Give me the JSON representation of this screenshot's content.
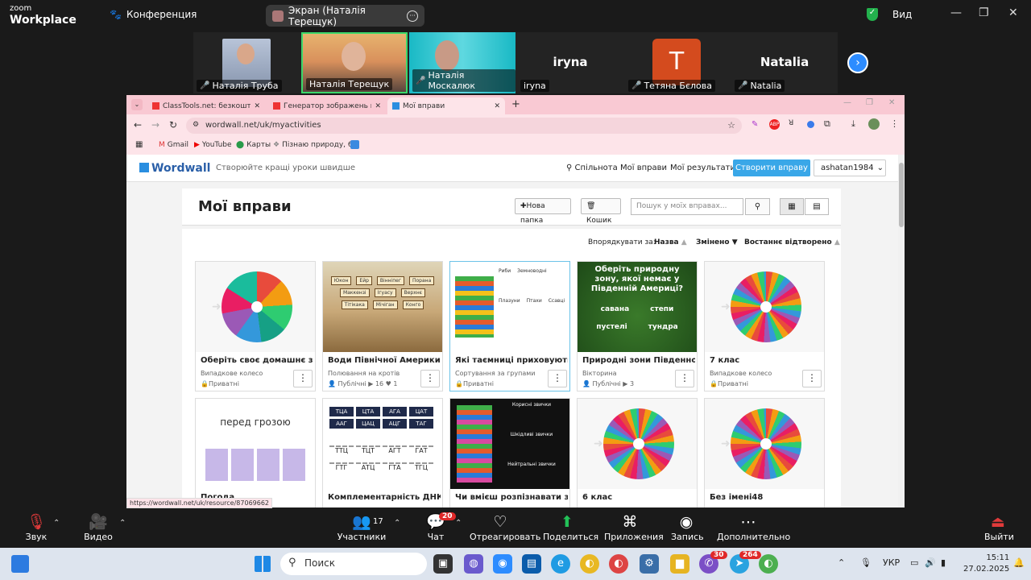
{
  "zoom": {
    "logo_top": "zoom",
    "logo_bottom": "Workplace",
    "meeting_label": "Конференция",
    "screen_share": "Экран (Наталія Терещук)",
    "view_label": "Вид",
    "participants": [
      {
        "name": "Наталія Труба",
        "type": "video"
      },
      {
        "name": "Наталія Терещук",
        "type": "video"
      },
      {
        "name": "Наталія Москалюк",
        "type": "video"
      },
      {
        "name": "iryna",
        "type": "text",
        "big": "iryna"
      },
      {
        "name": "Тетяна Бєлова",
        "type": "avatar",
        "big": "T"
      },
      {
        "name": "Natalia",
        "type": "text",
        "big": "Natalia"
      }
    ],
    "toolbar": {
      "audio": "Звук",
      "video": "Видео",
      "participants": "Участники",
      "participants_count": "17",
      "chat": "Чат",
      "chat_badge": "20",
      "react": "Отреагировать",
      "share": "Поделиться",
      "apps": "Приложения",
      "record": "Запись",
      "more": "Дополнительно",
      "leave": "Выйти"
    }
  },
  "browser": {
    "tabs": [
      {
        "label": "ClassTools.net: безкоштовні ін"
      },
      {
        "label": "Генератор зображень профіл"
      },
      {
        "label": "Мої вправи"
      }
    ],
    "url": "wordwall.net/uk/myactivities",
    "bookmarks": [
      "Gmail",
      "YouTube",
      "Карты",
      "Пізнаю природу, 6..."
    ],
    "status_url": "https://wordwall.net/uk/resource/87069662"
  },
  "wordwall": {
    "logo": "Wordwall",
    "tagline": "Створюйте кращі уроки швидше",
    "nav": [
      "Спільнота",
      "Мої вправи",
      "Мої результати"
    ],
    "create": "Створити вправу",
    "user": "ashatan1984",
    "title": "Мої вправи",
    "new_folder": "Нова папка",
    "trash": "Кошик",
    "search_placeholder": "Пошук у моїх вправах...",
    "sort_label": "Впорядкувати за:",
    "sort_name": "Назва",
    "sort_changed": "Змінено",
    "sort_opened": "Востаннє відтворено",
    "cards": [
      {
        "title": "Оберіть своє домашнє завда",
        "type": "Випадкове колесо",
        "meta": "Приватні"
      },
      {
        "title": "Води Північної Америки",
        "type": "Полювання на кротів",
        "meta": "Публічні ▶ 16 ♥ 1"
      },
      {
        "title": "Які таємниці приховують хре",
        "type": "Сортування за групами",
        "meta": "Приватні"
      },
      {
        "title": "Природні зони Південної Ам",
        "type": "Вікторина",
        "meta": "Публічні ▶ 3"
      },
      {
        "title": "7 клас",
        "type": "Випадкове колесо",
        "meta": "Приватні"
      },
      {
        "title": "Погода",
        "type": "",
        "meta": ""
      },
      {
        "title": "Комплементарність ДНК",
        "type": "",
        "meta": ""
      },
      {
        "title": "Чи вмієш розпізнавати звич",
        "type": "",
        "meta": ""
      },
      {
        "title": "6 клас",
        "type": "",
        "meta": ""
      },
      {
        "title": "Без імені48",
        "type": "",
        "meta": ""
      }
    ],
    "thumb_text": {
      "nature_q": "Оберіть природну зону, якої немає у Південній Америці?",
      "nature_a": [
        "савана",
        "степи",
        "пустелі",
        "тундра"
      ],
      "storm": "перед грозою",
      "dna_top": [
        "ТЦА",
        "ЦТА",
        "АГА",
        "ЦАТ",
        "ААГ",
        "ЦАЦ",
        "АЦГ",
        "ТАГ"
      ],
      "dna_bottom": [
        "ТТЦ",
        "ТЦТ",
        "АГТ",
        "ГАТ",
        "ГТГ",
        "АТЦ",
        "ГТА",
        "ТГЦ"
      ],
      "sort_groups": [
        "Риби",
        "Земноводні",
        "Плазуни",
        "Птахи",
        "Ссавці"
      ],
      "habits": [
        "Корисні звички",
        "Шкідливі звички",
        "Нейтральні звички"
      ],
      "map_labels": [
        "Юкон",
        "Ейр",
        "Вінніпег",
        "Порана",
        "Маккензі",
        "Ігуасу",
        "Верхнє",
        "Тітікака",
        "Мічіган",
        "Конго"
      ]
    }
  },
  "taskbar": {
    "search": "Поиск",
    "lang": "УКР",
    "time": "15:11",
    "date": "27.02.2025",
    "badge_viber": "30",
    "badge_tg": "264"
  }
}
